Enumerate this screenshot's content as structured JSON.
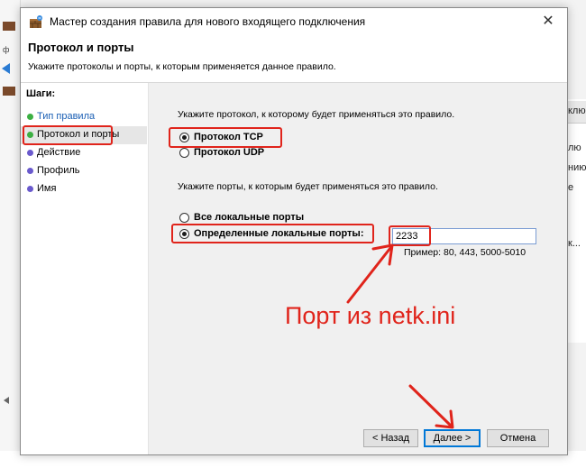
{
  "window": {
    "title": "Мастер создания правила для нового входящего подключения",
    "close_glyph": "✕"
  },
  "header": {
    "title": "Протокол и порты",
    "subtitle": "Укажите протоколы и порты, к которым применяется данное правило."
  },
  "steps": {
    "title": "Шаги:",
    "items": [
      {
        "label": "Тип правила",
        "color": "#3cb043",
        "state": "done"
      },
      {
        "label": "Протокол и порты",
        "color": "#3cb043",
        "state": "current"
      },
      {
        "label": "Действие",
        "color": "#6a5acd",
        "state": "pending"
      },
      {
        "label": "Профиль",
        "color": "#6a5acd",
        "state": "pending"
      },
      {
        "label": "Имя",
        "color": "#6a5acd",
        "state": "pending"
      }
    ]
  },
  "protocol": {
    "prompt": "Укажите протокол, к которому будет применяться это правило.",
    "tcp_label": "Протокол TCP",
    "udp_label": "Протокол UDP",
    "selected": "tcp"
  },
  "ports": {
    "prompt": "Укажите порты, к которым будет применяться это правило.",
    "all_label": "Все локальные порты",
    "specific_label": "Определенные локальные порты:",
    "selected": "specific",
    "value": "2233",
    "example": "Пример: 80, 443, 5000-5010"
  },
  "buttons": {
    "back": "< Назад",
    "next": "Далее >",
    "cancel": "Отмена"
  },
  "annotation": {
    "text": "Порт из netk.ini",
    "color": "#e0241b"
  },
  "background": {
    "right_header": "клюс",
    "right_items": [
      "лю",
      "нию",
      "е",
      "к..."
    ]
  }
}
